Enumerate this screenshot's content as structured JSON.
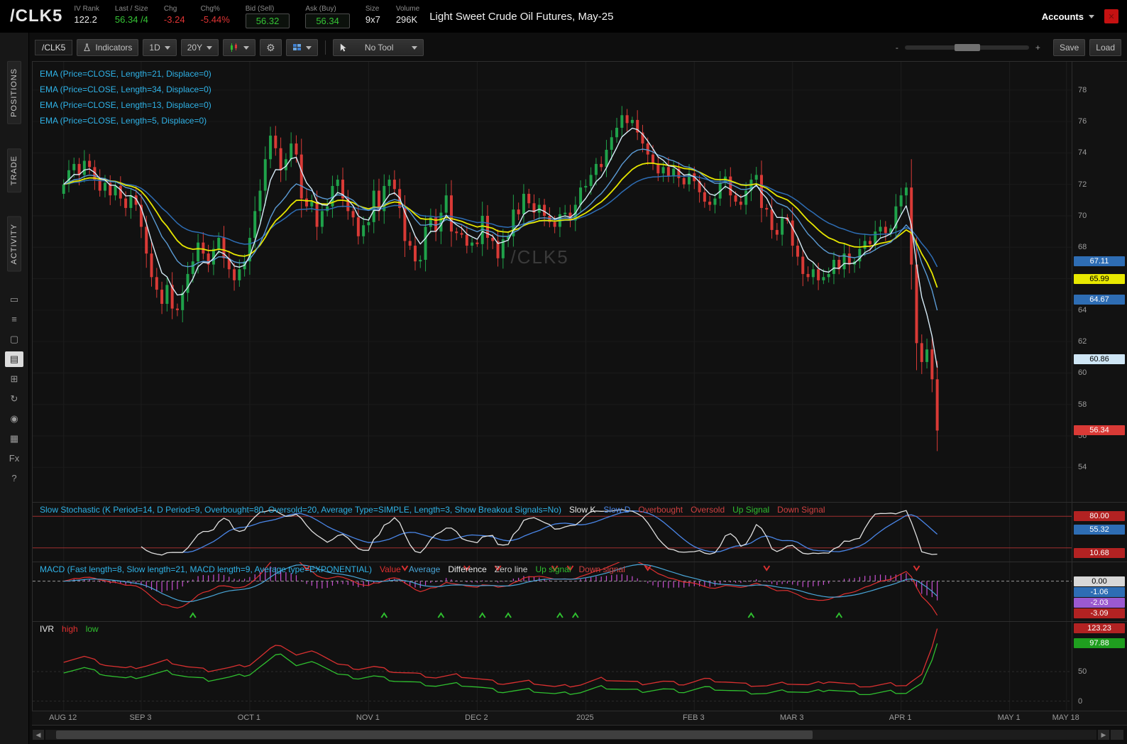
{
  "watermark": "/CLK5",
  "header": {
    "symbol": "/CLK5",
    "fields": [
      {
        "label": "IV Rank",
        "value": "122.2",
        "color": "#e8e8e8"
      },
      {
        "label": "Last / Size",
        "value": "56.34 /4",
        "color": "#35c435"
      },
      {
        "label": "Chg",
        "value": "-3.24",
        "color": "#e03434"
      },
      {
        "label": "Chg%",
        "value": "-5.44%",
        "color": "#e03434"
      },
      {
        "label": "Bid (Sell)",
        "value": "56.32",
        "color": "#35c435",
        "boxed": true
      },
      {
        "label": "Ask (Buy)",
        "value": "56.34",
        "color": "#35c435",
        "boxed": true
      },
      {
        "label": "Size",
        "value": "9x7",
        "color": "#e8e8e8"
      },
      {
        "label": "Volume",
        "value": "296K",
        "color": "#e8e8e8"
      }
    ],
    "description": "Light Sweet Crude Oil Futures, May-25",
    "accounts_label": "Accounts"
  },
  "sidebar": {
    "tabs": [
      "POSITIONS",
      "TRADE",
      "ACTIVITY"
    ],
    "icons": [
      {
        "name": "monitor-icon",
        "glyph": "▭"
      },
      {
        "name": "watchlist-icon",
        "glyph": "≡"
      },
      {
        "name": "tv-icon",
        "glyph": "▢"
      },
      {
        "name": "charts-icon",
        "glyph": "▤",
        "selected": true
      },
      {
        "name": "apps-grid-icon",
        "glyph": "⊞"
      },
      {
        "name": "history-icon",
        "glyph": "↻"
      },
      {
        "name": "community-icon",
        "glyph": "◉"
      },
      {
        "name": "calendar-icon",
        "glyph": "▦"
      },
      {
        "name": "fx-icon",
        "glyph": "Fx"
      },
      {
        "name": "help-icon",
        "glyph": "?"
      }
    ]
  },
  "toolbar": {
    "symbol": "/CLK5",
    "indicators_label": "Indicators",
    "timeframe": "1D",
    "range": "20Y",
    "tool_label": "No Tool",
    "zoom_minus": "-",
    "zoom_plus": "+",
    "save_label": "Save",
    "load_label": "Load"
  },
  "price_axis": {
    "ticks": [
      78,
      76,
      74,
      72,
      70,
      68,
      64,
      62,
      60,
      58,
      56,
      54
    ],
    "badges": [
      {
        "value": "67.11",
        "y": 67.11,
        "bg": "#2e6db4",
        "fg": "#ffffff"
      },
      {
        "value": "65.99",
        "y": 65.99,
        "bg": "#e8e800",
        "fg": "#000000"
      },
      {
        "value": "64.67",
        "y": 64.67,
        "bg": "#2e6db4",
        "fg": "#ffffff"
      },
      {
        "value": "60.86",
        "y": 60.86,
        "bg": "#cfe6f5",
        "fg": "#000000"
      },
      {
        "value": "56.34",
        "y": 56.34,
        "bg": "#d93a36",
        "fg": "#ffffff"
      }
    ]
  },
  "studies": {
    "ema_labels": [
      "EMA (Price=CLOSE, Length=21, Displace=0)",
      "EMA (Price=CLOSE, Length=34, Displace=0)",
      "EMA (Price=CLOSE, Length=13, Displace=0)",
      "EMA (Price=CLOSE, Length=5, Displace=0)"
    ],
    "stoch": {
      "label": "Slow Stochastic (K Period=14, D Period=9, Overbought=80, Oversold=20, Average Type=SIMPLE, Length=3, Show Breakout Signals=No)",
      "legend": [
        {
          "text": "Slow K",
          "color": "#e8e8e8"
        },
        {
          "text": "Slow D",
          "color": "#4a86e8"
        },
        {
          "text": "Overbought",
          "color": "#d04040"
        },
        {
          "text": "Oversold",
          "color": "#d04040"
        },
        {
          "text": "Up Signal",
          "color": "#2fbf2f"
        },
        {
          "text": "Down Signal",
          "color": "#d04040"
        }
      ],
      "badges": [
        {
          "value": "80.00",
          "y": 80,
          "bg": "#b22222",
          "fg": "#ffffff"
        },
        {
          "value": "55.32",
          "y": 55.32,
          "bg": "#2e6db4",
          "fg": "#ffffff"
        },
        {
          "value": "10.68",
          "y": 10.68,
          "bg": "#b22222",
          "fg": "#ffffff"
        }
      ]
    },
    "macd": {
      "label": "MACD (Fast length=8, Slow length=21, MACD length=9, Average type=EXPONENTIAL)",
      "legend": [
        {
          "text": "Value",
          "color": "#e03030"
        },
        {
          "text": "Average",
          "color": "#49a6d8"
        },
        {
          "text": "Difference",
          "color": "#e8e8e8"
        },
        {
          "text": "Zero line",
          "color": "#cccccc"
        },
        {
          "text": "Up signal",
          "color": "#2fbf2f"
        },
        {
          "text": "Down signal",
          "color": "#d04040"
        }
      ],
      "badges": [
        {
          "value": "0.00",
          "y": 0,
          "bg": "#d8d8d8",
          "fg": "#000000"
        },
        {
          "value": "-1.06",
          "y": -1.06,
          "bg": "#2e6db4",
          "fg": "#ffffff"
        },
        {
          "value": "-2.03",
          "y": -2.03,
          "bg": "#9b59d0",
          "fg": "#ffffff"
        },
        {
          "value": "-3.09",
          "y": -3.09,
          "bg": "#b22222",
          "fg": "#ffffff"
        }
      ]
    },
    "ivr": {
      "label": "IVR",
      "label_color": "#e8e8e8",
      "legend": [
        {
          "text": "high",
          "color": "#e03030"
        },
        {
          "text": "low",
          "color": "#2fbf2f"
        }
      ],
      "badges": [
        {
          "value": "123.23",
          "y": 123.2,
          "bg": "#b22222",
          "fg": "#ffffff"
        },
        {
          "value": "97.88",
          "y": 97.88,
          "bg": "#1f9e1f",
          "fg": "#ffffff"
        }
      ]
    }
  },
  "time_axis": {
    "labels": [
      {
        "text": "AUG 12",
        "i": 6
      },
      {
        "text": "SEP 3",
        "i": 21
      },
      {
        "text": "OCT 1",
        "i": 42
      },
      {
        "text": "NOV 1",
        "i": 65
      },
      {
        "text": "DEC 2",
        "i": 86
      },
      {
        "text": "2025",
        "i": 107
      },
      {
        "text": "FEB 3",
        "i": 128
      },
      {
        "text": "MAR 3",
        "i": 147
      },
      {
        "text": "APR 1",
        "i": 168
      },
      {
        "text": "MAY 1",
        "i": 189
      },
      {
        "text": "MAY 18",
        "i": 200
      }
    ]
  },
  "colors": {
    "candle_up": "#1fa24a",
    "candle_down": "#d93a36",
    "ema5": "#d6ebf7",
    "ema13": "#5b9bd5",
    "ema21": "#e6e600",
    "ema34": "#2e6db4",
    "stoch_k": "#e0e0e0",
    "stoch_d": "#4a86e8",
    "macd_value": "#e03030",
    "macd_avg": "#49a6d8",
    "macd_hist": "#c94fd2",
    "ivr_high": "#d93030",
    "ivr_low": "#2fbf2f",
    "up_signal": "#2fbf2f",
    "down_signal": "#d93030"
  },
  "chart_data": {
    "type": "candlestick",
    "symbol": "/CLK5",
    "aggregation": "1D",
    "range_setting": "20Y",
    "day_domain": 201,
    "data_offset": 6,
    "open_first": 71.4,
    "closes": [
      72.0,
      72.9,
      73.3,
      72.6,
      73.5,
      73.1,
      72.3,
      71.6,
      72.1,
      71.3,
      71.9,
      71.1,
      70.5,
      71.3,
      70.7,
      69.3,
      67.6,
      66.1,
      65.3,
      64.4,
      65.6,
      64.1,
      64.0,
      65.1,
      66.3,
      67.1,
      68.3,
      67.6,
      66.9,
      67.9,
      68.6,
      67.3,
      66.6,
      65.9,
      66.6,
      67.1,
      68.6,
      70.3,
      71.6,
      73.6,
      75.1,
      74.3,
      72.9,
      73.6,
      74.6,
      73.9,
      71.1,
      70.6,
      70.9,
      69.3,
      70.3,
      70.6,
      71.9,
      72.3,
      71.1,
      70.3,
      69.9,
      68.7,
      69.4,
      69.6,
      71.6,
      70.3,
      71.9,
      72.3,
      71.7,
      70.5,
      68.4,
      68.1,
      67.1,
      67.2,
      69.3,
      69.9,
      69.0,
      70.2,
      71.3,
      69.0,
      68.9,
      68.8,
      68.1,
      68.3,
      68.2,
      70.0,
      68.6,
      68.4,
      67.3,
      68.5,
      68.7,
      70.4,
      70.1,
      71.4,
      70.8,
      70.2,
      70.7,
      70.0,
      69.6,
      69.3,
      70.1,
      70.2,
      69.7,
      70.7,
      71.8,
      71.9,
      72.6,
      73.3,
      73.1,
      74.2,
      75.0,
      75.6,
      76.4,
      75.9,
      76.1,
      75.3,
      74.6,
      73.9,
      73.3,
      72.7,
      73.1,
      72.5,
      73.0,
      72.4,
      72.0,
      72.7,
      72.2,
      71.5,
      70.9,
      70.7,
      71.1,
      72.1,
      72.5,
      71.3,
      70.9,
      70.7,
      71.6,
      72.3,
      72.6,
      70.5,
      70.4,
      69.1,
      68.8,
      69.9,
      69.7,
      68.1,
      67.4,
      66.3,
      66.1,
      66.6,
      65.9,
      66.1,
      66.3,
      67.2,
      66.6,
      67.6,
      66.9,
      67.1,
      67.9,
      68.4,
      68.2,
      69.0,
      69.3,
      68.9,
      69.2,
      70.6,
      71.3,
      71.8,
      66.9,
      61.9,
      60.7,
      61.5,
      59.6,
      56.34
    ],
    "gridline_prices": [
      54,
      56,
      58,
      60,
      62,
      64,
      66,
      68,
      70,
      72,
      74,
      76,
      78
    ],
    "panels": {
      "price": {
        "range": [
          51.8,
          79.8
        ]
      },
      "stochastic": {
        "range": [
          -6,
          106
        ],
        "overbought": 80,
        "oversold": 20,
        "k_period": 14,
        "d_period": 9,
        "length": 3
      },
      "macd": {
        "range": [
          -3.8,
          1.8
        ],
        "fast": 8,
        "slow": 21,
        "signal": 9
      },
      "ivr": {
        "range": [
          -16,
          134
        ],
        "gridlines": [
          50,
          0
        ],
        "high_series_points": [
          [
            0,
            68
          ],
          [
            4,
            75
          ],
          [
            8,
            62
          ],
          [
            12,
            55
          ],
          [
            16,
            60
          ],
          [
            20,
            68
          ],
          [
            24,
            58
          ],
          [
            28,
            52
          ],
          [
            32,
            56
          ],
          [
            36,
            62
          ],
          [
            40,
            88
          ],
          [
            42,
            96
          ],
          [
            45,
            78
          ],
          [
            49,
            84
          ],
          [
            53,
            62
          ],
          [
            57,
            55
          ],
          [
            60,
            58
          ],
          [
            64,
            50
          ],
          [
            68,
            46
          ],
          [
            72,
            40
          ],
          [
            76,
            44
          ],
          [
            80,
            38
          ],
          [
            85,
            30
          ],
          [
            90,
            33
          ],
          [
            95,
            24
          ],
          [
            100,
            28
          ],
          [
            104,
            38
          ],
          [
            108,
            34
          ],
          [
            112,
            30
          ],
          [
            116,
            33
          ],
          [
            120,
            29
          ],
          [
            124,
            37
          ],
          [
            128,
            33
          ],
          [
            132,
            28
          ],
          [
            136,
            26
          ],
          [
            140,
            31
          ],
          [
            144,
            27
          ],
          [
            148,
            34
          ],
          [
            152,
            28
          ],
          [
            156,
            25
          ],
          [
            160,
            29
          ],
          [
            163,
            27
          ],
          [
            166,
            45
          ],
          [
            168,
            92
          ],
          [
            169,
            123
          ]
        ],
        "low_series_points": [
          [
            0,
            50
          ],
          [
            4,
            56
          ],
          [
            8,
            45
          ],
          [
            12,
            38
          ],
          [
            16,
            43
          ],
          [
            20,
            50
          ],
          [
            24,
            41
          ],
          [
            28,
            36
          ],
          [
            32,
            40
          ],
          [
            36,
            46
          ],
          [
            40,
            70
          ],
          [
            42,
            82
          ],
          [
            45,
            60
          ],
          [
            49,
            66
          ],
          [
            53,
            45
          ],
          [
            57,
            39
          ],
          [
            60,
            42
          ],
          [
            64,
            35
          ],
          [
            68,
            31
          ],
          [
            72,
            26
          ],
          [
            76,
            29
          ],
          [
            80,
            24
          ],
          [
            85,
            16
          ],
          [
            90,
            19
          ],
          [
            95,
            12
          ],
          [
            100,
            15
          ],
          [
            104,
            24
          ],
          [
            108,
            20
          ],
          [
            112,
            17
          ],
          [
            116,
            20
          ],
          [
            120,
            16
          ],
          [
            124,
            23
          ],
          [
            128,
            19
          ],
          [
            132,
            15
          ],
          [
            136,
            13
          ],
          [
            140,
            18
          ],
          [
            144,
            14
          ],
          [
            148,
            20
          ],
          [
            152,
            15
          ],
          [
            156,
            12
          ],
          [
            160,
            16
          ],
          [
            163,
            14
          ],
          [
            166,
            30
          ],
          [
            168,
            70
          ],
          [
            169,
            98
          ]
        ]
      }
    }
  }
}
